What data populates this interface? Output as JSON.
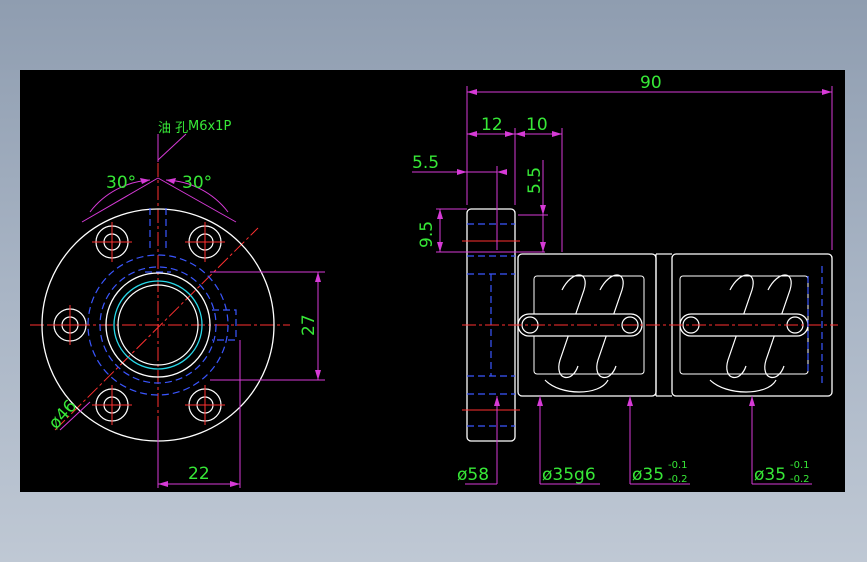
{
  "colors": {
    "background": "#000000",
    "outline": "#ffffff",
    "dimension": "#d63ad6",
    "center": "#ff3030",
    "hidden": "#3a56ff",
    "text": "#37e837",
    "cyan": "#28d8e8",
    "yellow": "#e8e838"
  },
  "front_view": {
    "oil_hole_label": "油 孔",
    "thread_label": "M6x1P",
    "angle_left": "30°",
    "angle_right": "30°",
    "dim_height": "27",
    "dim_width": "22",
    "dim_pcd": "ø46"
  },
  "side_view": {
    "dim_total": "90",
    "dim_flange": "12",
    "dim_step": "10",
    "dim_55_h": "5.5",
    "dim_55_v": "5.5",
    "dim_95": "9.5",
    "dim_d58": "ø58",
    "dim_d35g6": "ø35g6",
    "dim_d35_a": "ø35",
    "tol_a_upper": "-0.1",
    "tol_a_lower": "-0.2",
    "dim_d35_b": "ø35",
    "tol_b_upper": "-0.1",
    "tol_b_lower": "-0.2"
  }
}
